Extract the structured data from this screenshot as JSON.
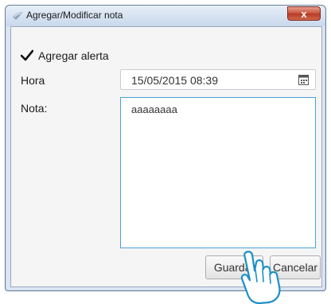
{
  "window": {
    "title": "Agregar/Modificar nota",
    "close_label": "x"
  },
  "form": {
    "alert_checkbox": {
      "checked": true,
      "label": "Agregar alerta"
    },
    "hora_label": "Hora",
    "hora_value": "15/05/2015 08:39",
    "nota_label": "Nota:",
    "nota_value": "aaaaaaaa"
  },
  "buttons": {
    "save_label": "Guardar",
    "cancel_label": "Cancelar"
  },
  "icons": {
    "app": "note-app-icon",
    "close": "close-icon",
    "check": "checkmark-icon",
    "calendar": "calendar-icon",
    "cursor": "hand-pointer-cursor"
  },
  "colors": {
    "titlebar": "#c8d8ec",
    "close_button": "#c75038",
    "focus_border": "#4aa3d6"
  }
}
